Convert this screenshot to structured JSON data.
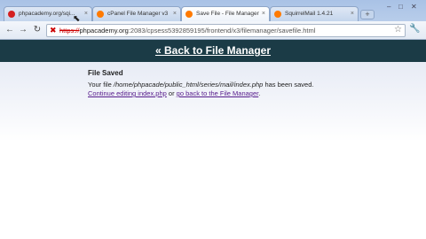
{
  "colors": {
    "header_bar": "#1b3b46",
    "link": "#551a8b",
    "error_scheme": "#cc0000"
  },
  "tabs": [
    {
      "title": "phpacademy.org/sqi...",
      "icon": "youtube-icon",
      "color": "#d42020"
    },
    {
      "title": "cPanel File Manager v3",
      "icon": "cpanel-icon",
      "color": "#ff7a00"
    },
    {
      "title": "Save File - File Manager",
      "icon": "cpanel-icon",
      "color": "#ff7a00"
    },
    {
      "title": "SquirrelMail 1.4.21",
      "icon": "cpanel-icon",
      "color": "#ff7a00"
    }
  ],
  "newtab_label": "+",
  "omnibox": {
    "scheme": "https://",
    "host": "phpacademy.org",
    "rest": ":2083/cpsess5392859195/frontend/x3/filemanager/savefile.html"
  },
  "page": {
    "back_link": "« Back to File Manager",
    "heading": "File Saved",
    "line1_pre": "Your file ",
    "line1_path": "/home/phpacade/public_html/series/mail/index.php",
    "line1_post": " has been saved.",
    "continue_link": "Continue editing index.php",
    "or_text": " or ",
    "back_fm_link": "go back to the File Manager",
    "period": "."
  }
}
